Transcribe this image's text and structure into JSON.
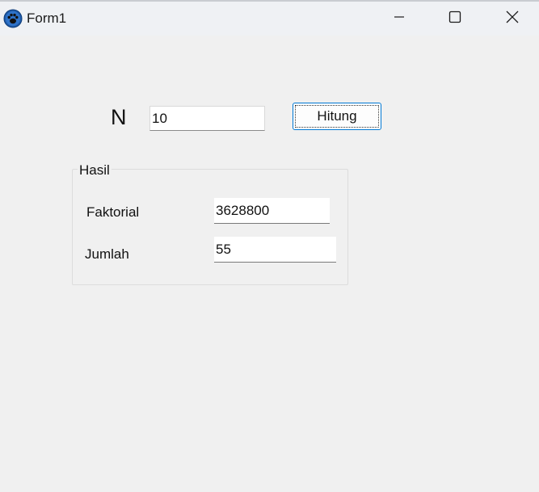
{
  "window": {
    "title": "Form1",
    "app_icon": "paw-icon",
    "controls": {
      "minimize_icon": "minimize-icon",
      "maximize_icon": "maximize-icon",
      "close_icon": "close-icon"
    }
  },
  "form": {
    "n_label": "N",
    "n_value": "10",
    "hitung_label": "Hitung"
  },
  "hasil": {
    "group_label": "Hasil",
    "faktorial_label": "Faktorial",
    "faktorial_value": "3628800",
    "jumlah_label": "Jumlah",
    "jumlah_value": "55"
  },
  "colors": {
    "background": "#f0f0f0",
    "titlebar": "#eff1f4",
    "button_focus_border": "#0078d4",
    "app_icon_blue": "#1e5aa8"
  }
}
